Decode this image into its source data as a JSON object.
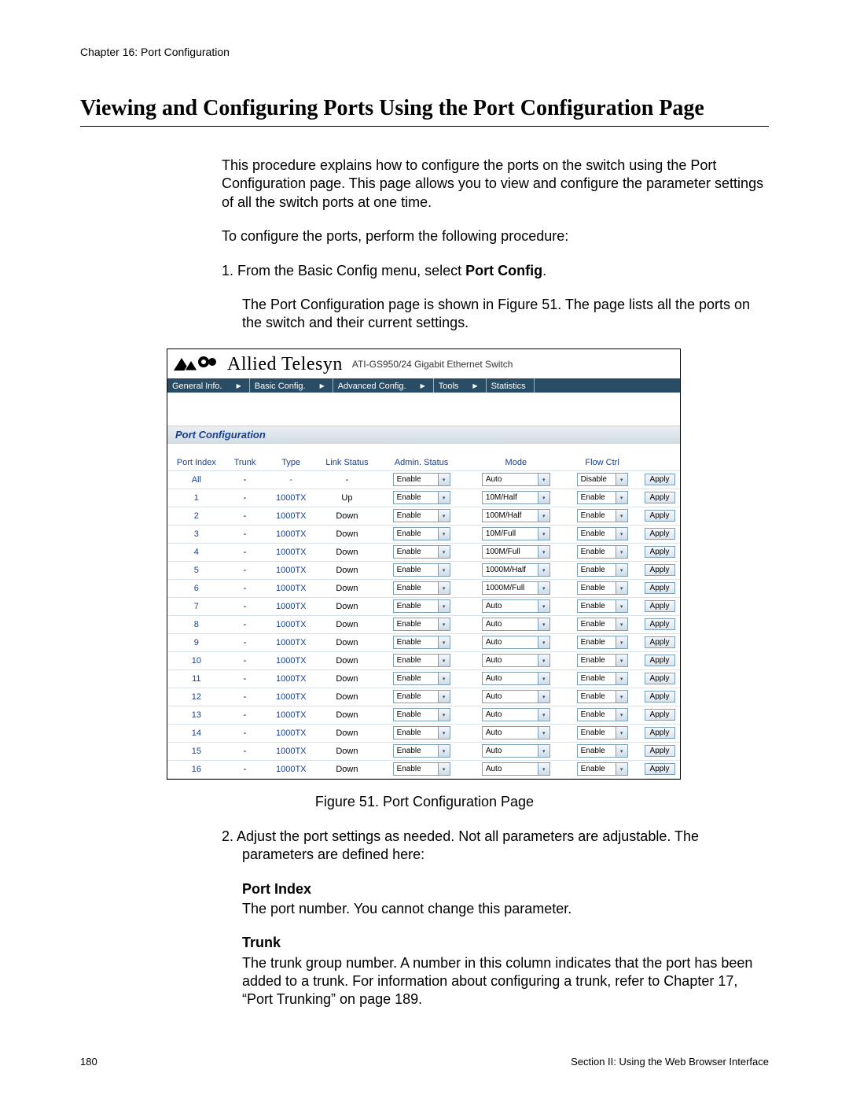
{
  "header": {
    "chapter": "Chapter 16: Port Configuration"
  },
  "heading": "Viewing and Configuring Ports Using the Port Configuration Page",
  "intro_p1": "This procedure explains how to configure the ports on the switch using the Port Configuration page. This page allows you to view and configure the parameter settings of all the switch ports at one time.",
  "intro_p2": "To configure the ports, perform the following procedure:",
  "step1_prefix": "1.   From the Basic Config menu, select ",
  "step1_bold": "Port Config",
  "step1_suffix": ".",
  "step1_body": "The Port Configuration page is shown in Figure 51. The page lists all the ports on the switch and their current settings.",
  "screenshot": {
    "brand": "Allied Telesyn",
    "device": "ATI-GS950/24 Gigabit Ethernet Switch",
    "menus": [
      "General Info.",
      "Basic Config.",
      "Advanced Config.",
      "Tools",
      "Statistics"
    ],
    "section_title": "Port Configuration",
    "columns": [
      "Port Index",
      "Trunk",
      "Type",
      "Link Status",
      "Admin. Status",
      "Mode",
      "Flow Ctrl",
      ""
    ],
    "rows": [
      {
        "idx": "All",
        "trunk": "-",
        "type": "-",
        "link": "-",
        "admin": "Enable",
        "mode": "Auto",
        "flow": "Disable",
        "apply": "Apply"
      },
      {
        "idx": "1",
        "trunk": "-",
        "type": "1000TX",
        "link": "Up",
        "admin": "Enable",
        "mode": "10M/Half",
        "flow": "Enable",
        "apply": "Apply"
      },
      {
        "idx": "2",
        "trunk": "-",
        "type": "1000TX",
        "link": "Down",
        "admin": "Enable",
        "mode": "100M/Half",
        "flow": "Enable",
        "apply": "Apply"
      },
      {
        "idx": "3",
        "trunk": "-",
        "type": "1000TX",
        "link": "Down",
        "admin": "Enable",
        "mode": "10M/Full",
        "flow": "Enable",
        "apply": "Apply"
      },
      {
        "idx": "4",
        "trunk": "-",
        "type": "1000TX",
        "link": "Down",
        "admin": "Enable",
        "mode": "100M/Full",
        "flow": "Enable",
        "apply": "Apply"
      },
      {
        "idx": "5",
        "trunk": "-",
        "type": "1000TX",
        "link": "Down",
        "admin": "Enable",
        "mode": "1000M/Half",
        "flow": "Enable",
        "apply": "Apply"
      },
      {
        "idx": "6",
        "trunk": "-",
        "type": "1000TX",
        "link": "Down",
        "admin": "Enable",
        "mode": "1000M/Full",
        "flow": "Enable",
        "apply": "Apply"
      },
      {
        "idx": "7",
        "trunk": "-",
        "type": "1000TX",
        "link": "Down",
        "admin": "Enable",
        "mode": "Auto",
        "flow": "Enable",
        "apply": "Apply"
      },
      {
        "idx": "8",
        "trunk": "-",
        "type": "1000TX",
        "link": "Down",
        "admin": "Enable",
        "mode": "Auto",
        "flow": "Enable",
        "apply": "Apply"
      },
      {
        "idx": "9",
        "trunk": "-",
        "type": "1000TX",
        "link": "Down",
        "admin": "Enable",
        "mode": "Auto",
        "flow": "Enable",
        "apply": "Apply"
      },
      {
        "idx": "10",
        "trunk": "-",
        "type": "1000TX",
        "link": "Down",
        "admin": "Enable",
        "mode": "Auto",
        "flow": "Enable",
        "apply": "Apply"
      },
      {
        "idx": "11",
        "trunk": "-",
        "type": "1000TX",
        "link": "Down",
        "admin": "Enable",
        "mode": "Auto",
        "flow": "Enable",
        "apply": "Apply"
      },
      {
        "idx": "12",
        "trunk": "-",
        "type": "1000TX",
        "link": "Down",
        "admin": "Enable",
        "mode": "Auto",
        "flow": "Enable",
        "apply": "Apply"
      },
      {
        "idx": "13",
        "trunk": "-",
        "type": "1000TX",
        "link": "Down",
        "admin": "Enable",
        "mode": "Auto",
        "flow": "Enable",
        "apply": "Apply"
      },
      {
        "idx": "14",
        "trunk": "-",
        "type": "1000TX",
        "link": "Down",
        "admin": "Enable",
        "mode": "Auto",
        "flow": "Enable",
        "apply": "Apply"
      },
      {
        "idx": "15",
        "trunk": "-",
        "type": "1000TX",
        "link": "Down",
        "admin": "Enable",
        "mode": "Auto",
        "flow": "Enable",
        "apply": "Apply"
      },
      {
        "idx": "16",
        "trunk": "-",
        "type": "1000TX",
        "link": "Down",
        "admin": "Enable",
        "mode": "Auto",
        "flow": "Enable",
        "apply": "Apply"
      }
    ]
  },
  "figure_caption": "Figure 51. Port Configuration Page",
  "step2": "2.   Adjust the port settings as needed. Not all parameters are adjustable. The parameters are defined here:",
  "params": {
    "port_index_title": "Port Index",
    "port_index_body": "The port number. You cannot change this parameter.",
    "trunk_title": "Trunk",
    "trunk_body": "The trunk group number. A number in this column indicates that the port has been added to a trunk. For information about configuring a trunk, refer to Chapter 17, “Port Trunking” on page 189."
  },
  "footer": {
    "page": "180",
    "section": "Section II: Using the Web Browser Interface"
  }
}
